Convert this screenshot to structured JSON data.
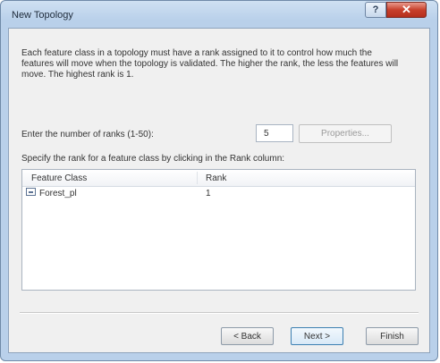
{
  "window": {
    "title": "New Topology",
    "help_label": "?",
    "close_label": "✕"
  },
  "description": "Each feature class in a topology must have a rank assigned to it to control how much the features will move when the topology is validated. The higher the rank, the less the features will move. The highest rank is 1.",
  "ranks": {
    "label": "Enter the number of ranks (1-50):",
    "value": "5",
    "properties_button": "Properties..."
  },
  "table": {
    "instruction": "Specify the rank for a feature class by clicking in the Rank column:",
    "columns": [
      "Feature Class",
      "Rank"
    ],
    "rows": [
      {
        "feature_class": "Forest_pl",
        "rank": "1"
      }
    ]
  },
  "buttons": {
    "back": "< Back",
    "next": "Next >",
    "finish": "Finish"
  },
  "icons": {
    "feature_class_row": "polygon-feature-class-icon"
  },
  "colors": {
    "close_button": "#c8402c",
    "title_bar": "#b9d0ea",
    "default_button_border": "#3c7fb1"
  }
}
